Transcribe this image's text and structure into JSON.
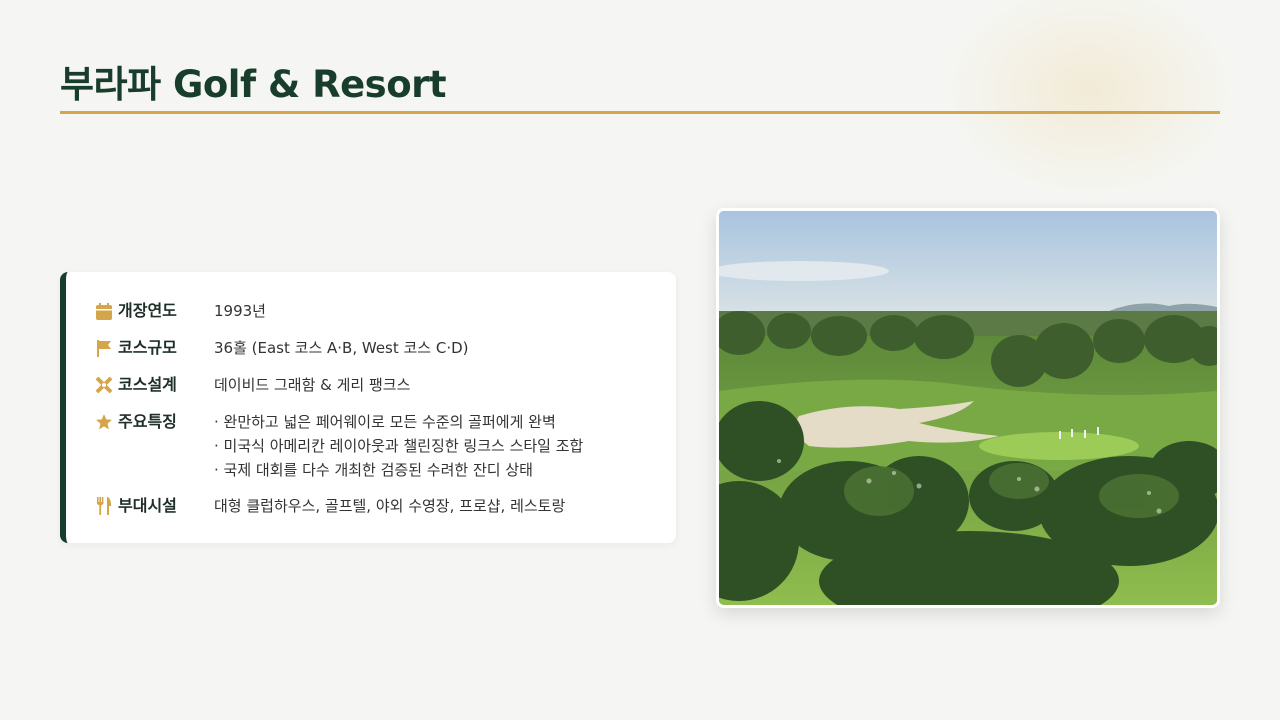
{
  "page": {
    "title": "부라파 Golf & Resort"
  },
  "info": {
    "rows": [
      {
        "icon": "calendar-icon",
        "label": "개장연도",
        "value": "1993년"
      },
      {
        "icon": "flag-icon",
        "label": "코스규모",
        "value": "36홀 (East 코스 A·B, West 코스 C·D)"
      },
      {
        "icon": "design-tools-icon",
        "label": "코스설계",
        "value": "데이비드 그래함 & 게리 팽크스"
      },
      {
        "icon": "star-icon",
        "label": "주요특징",
        "features": [
          "· 완만하고 넓은 페어웨이로 모든 수준의 골퍼에게 완벽",
          "· 미국식 아메리칸 레이아웃과 챌린징한 링크스 스타일 조합",
          "· 국제 대회를 다수 개최한 검증된 수려한 잔디 상태"
        ]
      },
      {
        "icon": "utensils-icon",
        "label": "부대시설",
        "value": "대형 클럽하우스, 골프텔, 야외 수영장, 프로샵, 레스토랑"
      }
    ]
  },
  "colors": {
    "title": "#183d2c",
    "accent_gold": "#d4a54a",
    "card_border": "#183d2c"
  },
  "photo": {
    "subject": "golf-course-photo"
  }
}
